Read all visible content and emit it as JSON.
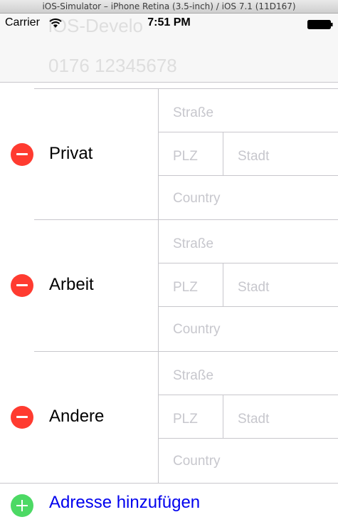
{
  "window": {
    "title": "iOS-Simulator – iPhone Retina (3.5-inch) / iOS 7.1 (11D167)"
  },
  "status_bar": {
    "carrier": "Carrier",
    "time": "7:51 PM"
  },
  "header": {
    "name_ghost": "iOS-Develo",
    "phone_ghost": "0176 12345678"
  },
  "placeholders": {
    "street": "Straße",
    "zip": "PLZ",
    "city": "Stadt",
    "country": "Country"
  },
  "addresses": [
    {
      "label": "Privat"
    },
    {
      "label": "Arbeit"
    },
    {
      "label": "Andere"
    }
  ],
  "add_address": {
    "label": "Adresse hinzufügen"
  },
  "colors": {
    "delete": "#ff3b30",
    "add": "#4cd964",
    "link": "#0000ee",
    "placeholder": "#c7c7cd"
  }
}
